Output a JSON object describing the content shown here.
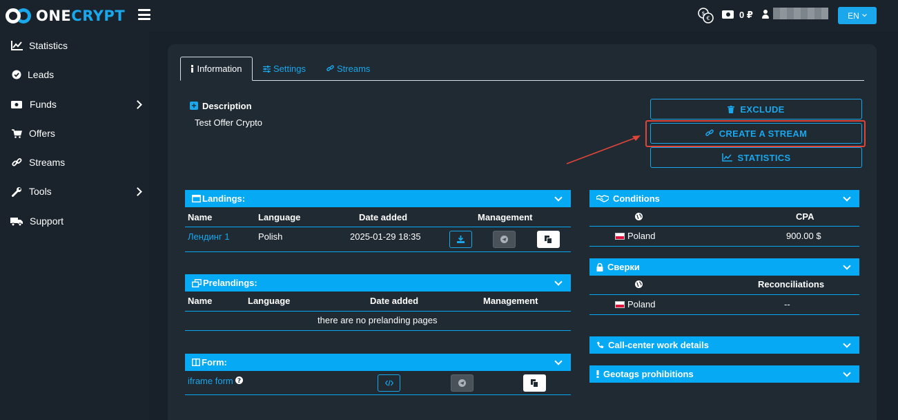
{
  "header": {
    "logo_prefix": "ONE",
    "logo_accent": "CRYPT",
    "balance": "0 ₽",
    "language": "EN"
  },
  "sidebar": {
    "items": [
      {
        "label": "Statistics",
        "icon": "chart-line-icon"
      },
      {
        "label": "Leads",
        "icon": "check-circle-icon"
      },
      {
        "label": "Funds",
        "icon": "money-bill-icon"
      },
      {
        "label": "Offers",
        "icon": "shopping-cart-icon"
      },
      {
        "label": "Streams",
        "icon": "link-icon"
      },
      {
        "label": "Tools",
        "icon": "wrench-icon"
      },
      {
        "label": "Support",
        "icon": "truck-icon"
      }
    ]
  },
  "tabs": [
    {
      "label": "Information"
    },
    {
      "label": "Settings"
    },
    {
      "label": "Streams"
    }
  ],
  "description": {
    "title": "Description",
    "text": "Test Offer Crypto"
  },
  "actions": {
    "exclude": "EXCLUDE",
    "create_stream": "CREATE A STREAM",
    "statistics": "STATISTICS"
  },
  "landings": {
    "title": "Landings:",
    "columns": [
      "Name",
      "Language",
      "Date added",
      "Management"
    ],
    "rows": [
      {
        "name": "Лендинг 1",
        "language": "Polish",
        "date": "2025-01-29 18:35"
      }
    ]
  },
  "prelandings": {
    "title": "Prelandings:",
    "columns": [
      "Name",
      "Language",
      "Date added",
      "Management"
    ],
    "empty": "there are no prelanding pages"
  },
  "form": {
    "title": "Form:",
    "link": "iframe form"
  },
  "conditions": {
    "title": "Conditions",
    "column": "CPA",
    "row": {
      "country": "Poland",
      "value": "900.00 $"
    }
  },
  "sverki": {
    "title": "Сверки",
    "column": "Reconciliations",
    "row": {
      "country": "Poland",
      "value": "--"
    }
  },
  "callcenter": {
    "title": "Call-center work details"
  },
  "geotags": {
    "title": "Geotags prohibitions"
  }
}
